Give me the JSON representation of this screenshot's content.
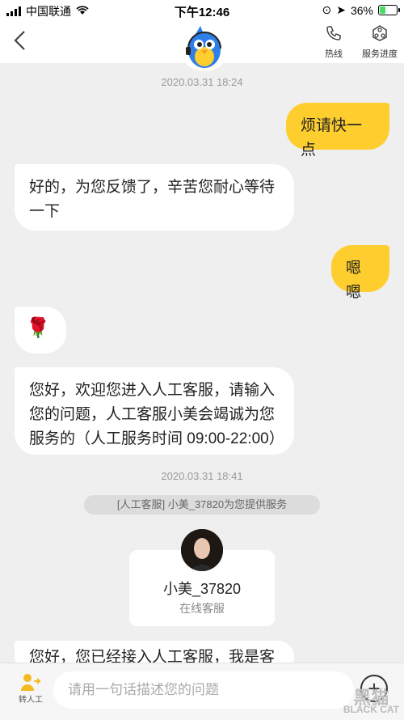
{
  "status": {
    "carrier": "中国联通",
    "time": "下午12:46",
    "battery": "36%",
    "battery_level": 0.36
  },
  "header": {
    "hotline_label": "热线",
    "progress_label": "服务进度",
    "back_icon": "chevron-left-icon"
  },
  "chat": {
    "ts1": "2020.03.31 18:24",
    "msg1": "烦请快一点",
    "msg2": "好的，为您反馈了，辛苦您耐心等待一下",
    "msg3": "嗯嗯",
    "msg4_emoji": "🌹",
    "msg5": "您好，欢迎您进入人工客服，请输入您的问题，人工客服小美会竭诚为您服务的（人工服务时间 09:00-22:00）",
    "ts2": "2020.03.31 18:41",
    "system_note": "[人工客服] 小美_37820为您提供服务",
    "agent_name": "小美_37820",
    "agent_role": "在线客服",
    "msg6": "您好，您已经接入人工客服，我是客"
  },
  "input": {
    "transfer_label": "转人工",
    "placeholder": "请用一句话描述您的问题",
    "plus": "+"
  },
  "watermark": {
    "big": "黑猫",
    "small": "BLACK CAT"
  },
  "colors": {
    "accent": "#fecd2e",
    "background": "#efefef"
  }
}
